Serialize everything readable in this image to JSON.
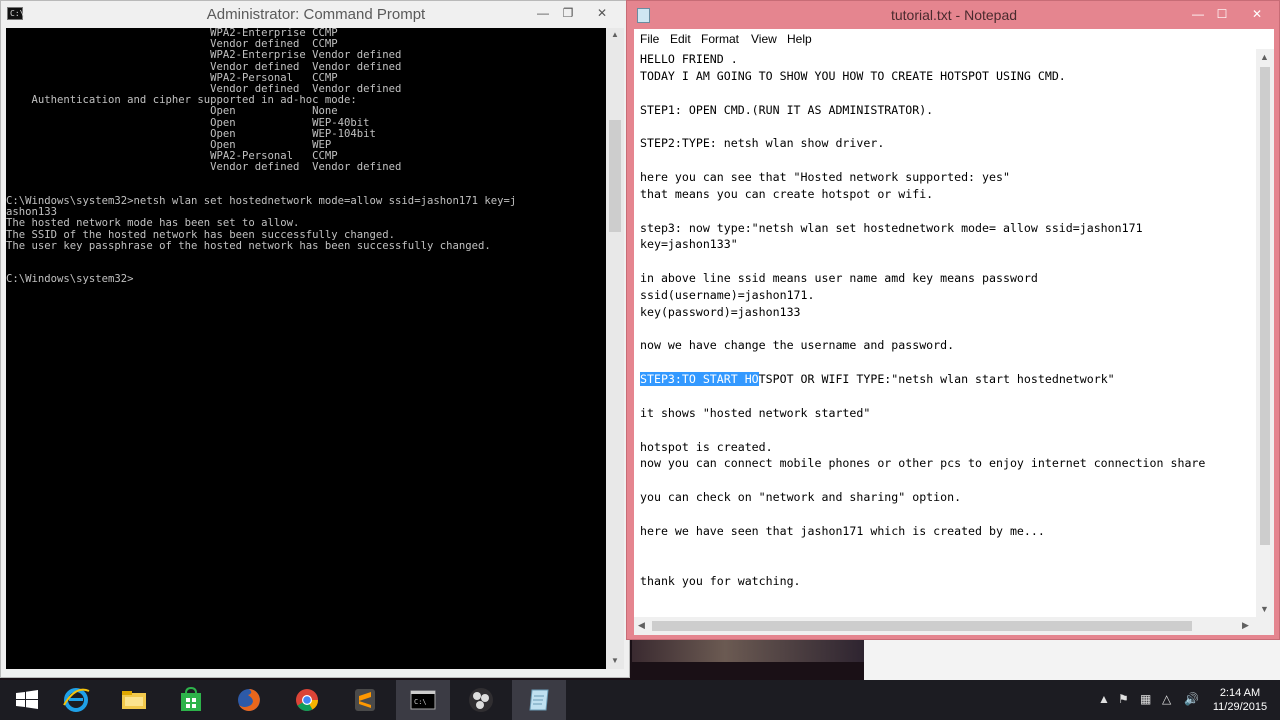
{
  "cmd": {
    "title": "Administrator: Command Prompt",
    "icon": "cmd-icon",
    "lines": [
      "                                WPA2-Enterprise CCMP",
      "                                Vendor defined  CCMP",
      "                                WPA2-Enterprise Vendor defined",
      "                                Vendor defined  Vendor defined",
      "                                WPA2-Personal   CCMP",
      "                                Vendor defined  Vendor defined",
      "    Authentication and cipher supported in ad-hoc mode:",
      "                                Open            None",
      "                                Open            WEP-40bit",
      "                                Open            WEP-104bit",
      "                                Open            WEP",
      "                                WPA2-Personal   CCMP",
      "                                Vendor defined  Vendor defined",
      "",
      "",
      "C:\\Windows\\system32>netsh wlan set hostednetwork mode=allow ssid=jashon171 key=j",
      "ashon133",
      "The hosted network mode has been set to allow.",
      "The SSID of the hosted network has been successfully changed.",
      "The user key passphrase of the hosted network has been successfully changed.",
      "",
      "",
      "C:\\Windows\\system32>"
    ]
  },
  "notepad": {
    "title": "tutorial.txt - Notepad",
    "menu": [
      "File",
      "Edit",
      "Format",
      "View",
      "Help"
    ],
    "lines": [
      "HELLO FRIEND .",
      "TODAY I AM GOING TO SHOW YOU HOW TO CREATE HOTSPOT USING CMD.",
      "",
      "STEP1: OPEN CMD.(RUN IT AS ADMINISTRATOR).",
      "",
      "STEP2:TYPE: netsh wlan show driver.",
      "",
      "here you can see that \"Hosted network supported: yes\"",
      "that means you can create hotspot or wifi.",
      "",
      "step3: now type:\"netsh wlan set hostednetwork mode= allow ssid=jashon171",
      "key=jashon133\"",
      "",
      "in above line ssid means user name amd key means password",
      "ssid(username)=jashon171.",
      "key(password)=jashon133",
      "",
      "now we have change the username and password.",
      "",
      "",
      "",
      "it shows \"hosted network started\"",
      "",
      "hotspot is created.",
      "now you can connect mobile phones or other pcs to enjoy internet connection share",
      "",
      "you can check on \"network and sharing\" option.",
      "",
      "here we have seen that jashon171 which is created by me...",
      "",
      "",
      "thank you for watching."
    ],
    "selected_text": "STEP3:TO START HO",
    "after_selection": "TSPOT OR WIFI TYPE:\"netsh wlan start hostednetwork\"",
    "selected_line_index": 19
  },
  "taskbar": {
    "apps": [
      "start-icon",
      "internet-explorer-icon",
      "file-explorer-icon",
      "store-icon",
      "firefox-icon",
      "chrome-icon",
      "sublime-icon",
      "cmd-icon",
      "obs-icon",
      "notepad-icon"
    ],
    "time": "2:14 AM",
    "date": "11/29/2015"
  }
}
